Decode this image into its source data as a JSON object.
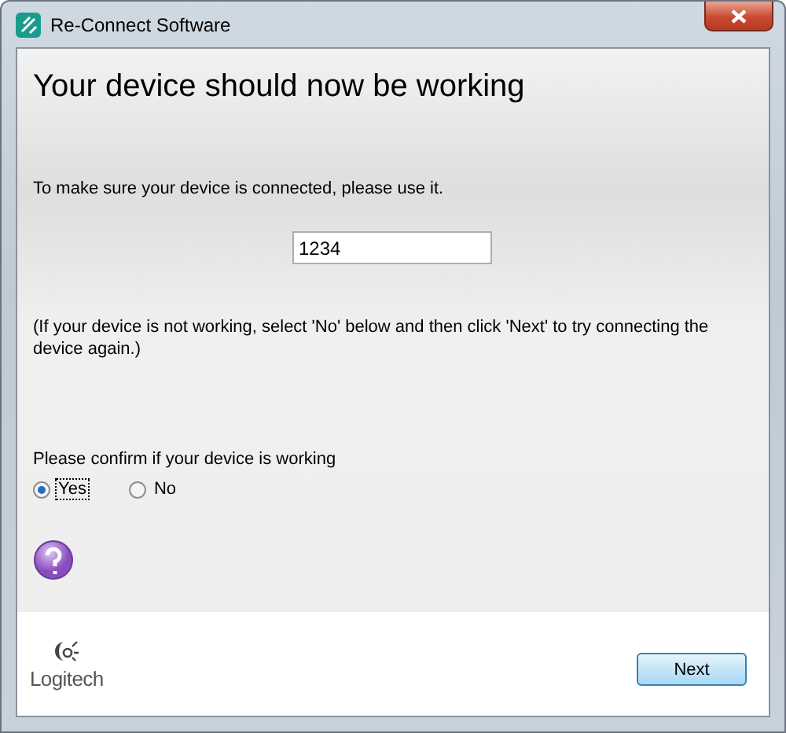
{
  "window": {
    "title": "Re-Connect Software"
  },
  "heading": "Your device should now be working",
  "instruction": "To make sure your device is connected, please use it.",
  "test_field": {
    "value": "1234"
  },
  "note": "(If your device is not working, select 'No' below and then click 'Next' to try connecting the device again.)",
  "question": "Please confirm if your device is working",
  "options": [
    {
      "label": "Yes",
      "selected": true
    },
    {
      "label": "No",
      "selected": false
    }
  ],
  "logo_text": "Logitech",
  "buttons": [
    "Next"
  ]
}
